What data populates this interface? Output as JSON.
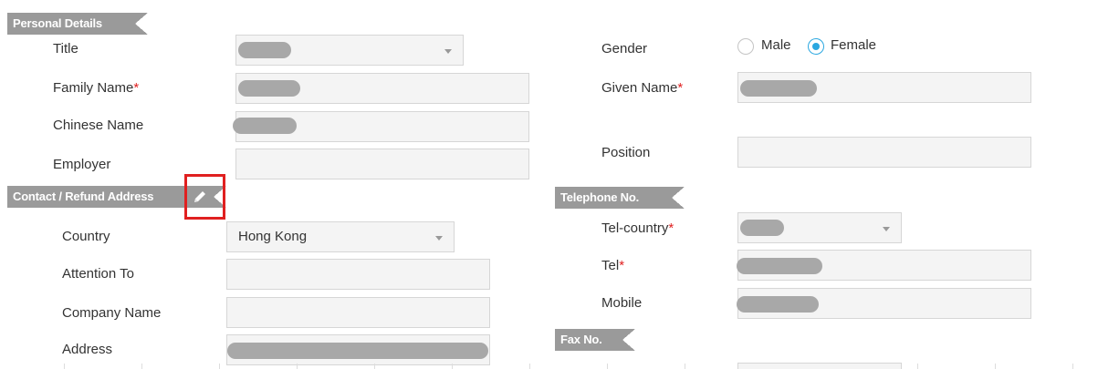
{
  "personal": {
    "header": "Personal Details",
    "title_label": "Title",
    "family_name_label": "Family Name",
    "given_name_label": "Given Name",
    "chinese_name_label": "Chinese Name",
    "employer_label": "Employer",
    "position_label": "Position",
    "gender_label": "Gender",
    "gender_options": [
      "Male",
      "Female"
    ],
    "gender_selected": "Female",
    "required_mark": "*"
  },
  "contact": {
    "header": "Contact / Refund Address",
    "country_label": "Country",
    "country_value": "Hong Kong",
    "attention_label": "Attention To",
    "company_label": "Company Name",
    "address_label": "Address"
  },
  "telephone": {
    "header": "Telephone No.",
    "tel_country_label": "Tel-country",
    "tel_label": "Tel",
    "mobile_label": "Mobile"
  },
  "fax": {
    "header": "Fax No."
  },
  "colors": {
    "ribbon": "#9a9a9a",
    "required": "#e02020",
    "radio_selected": "#2aa7e0",
    "highlight_box": "#e02020"
  }
}
